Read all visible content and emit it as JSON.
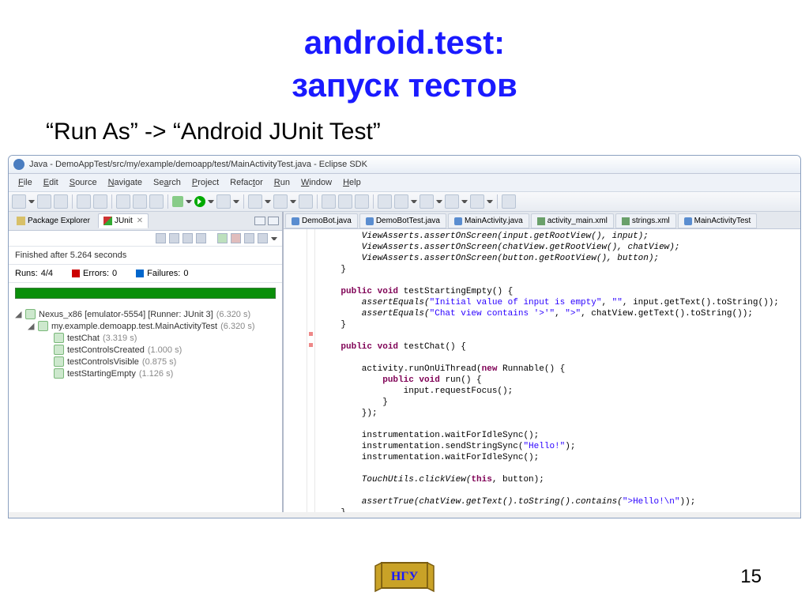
{
  "slide": {
    "title1": "android.test:",
    "title2": "запуск тестов",
    "subtitle": "“Run As” -> “Android JUnit Test”",
    "pageNum": "15"
  },
  "window": {
    "title": "Java - DemoAppTest/src/my/example/demoapp/test/MainActivityTest.java - Eclipse SDK"
  },
  "menu": [
    "File",
    "Edit",
    "Source",
    "Navigate",
    "Search",
    "Project",
    "Refactor",
    "Run",
    "Window",
    "Help"
  ],
  "leftPanel": {
    "tabs": {
      "pe": "Package Explorer",
      "junit": "JUnit"
    },
    "status": "Finished after 5.264 seconds",
    "runsLabel": "Runs:",
    "runsVal": "4/4",
    "errLabel": "Errors:",
    "errVal": "0",
    "failLabel": "Failures:",
    "failVal": "0",
    "tree": {
      "root": {
        "label": "Nexus_x86 [emulator-5554] [Runner: JUnit 3]",
        "dur": "(6.320 s)"
      },
      "pkg": {
        "label": "my.example.demoapp.test.MainActivityTest",
        "dur": "(6.320 s)"
      },
      "t1": {
        "label": "testChat",
        "dur": "(3.319 s)"
      },
      "t2": {
        "label": "testControlsCreated",
        "dur": "(1.000 s)"
      },
      "t3": {
        "label": "testControlsVisible",
        "dur": "(0.875 s)"
      },
      "t4": {
        "label": "testStartingEmpty",
        "dur": "(1.126 s)"
      }
    }
  },
  "editorTabs": [
    "DemoBot.java",
    "DemoBotTest.java",
    "MainActivity.java",
    "activity_main.xml",
    "strings.xml",
    "MainActivityTest"
  ],
  "code": {
    "l1": "        ViewAsserts.assertOnScreen(input.getRootView(), input);",
    "l2": "        ViewAsserts.assertOnScreen(chatView.getRootView(), chatView);",
    "l3": "        ViewAsserts.assertOnScreen(button.getRootView(), button);",
    "l4": "    }",
    "l5": "",
    "l6a": "    ",
    "l6kw": "public void",
    "l6b": " testStartingEmpty() {",
    "l7a": "        assertEquals(",
    "l7s1": "\"Initial value of input is empty\"",
    "l7b": ", ",
    "l7s2": "\"\"",
    "l7c": ", input.getText().toString());",
    "l8a": "        assertEquals(",
    "l8s1": "\"Chat view contains '>'\"",
    "l8b": ", ",
    "l8s2": "\">\"",
    "l8c": ", chatView.getText().toString());",
    "l9": "    }",
    "l10": "",
    "l11a": "    ",
    "l11kw": "public void",
    "l11b": " testChat() {",
    "l12": "",
    "l13a": "        activity.runOnUiThread(",
    "l13kw": "new",
    "l13b": " Runnable() {",
    "l14a": "            ",
    "l14kw": "public void",
    "l14b": " run() {",
    "l15": "                input.requestFocus();",
    "l16": "            }",
    "l17": "        });",
    "l18": "",
    "l19": "        instrumentation.waitForIdleSync();",
    "l20a": "        instrumentation.sendStringSync(",
    "l20s": "\"Hello!\"",
    "l20b": ");",
    "l21": "        instrumentation.waitForIdleSync();",
    "l22": "",
    "l23a": "        TouchUtils.clickView(",
    "l23kw": "this",
    "l23b": ", button);",
    "l24": "",
    "l25a": "        assertTrue(chatView.getText().toString().contains(",
    "l25s": "\">Hello!\\n\"",
    "l25b": "));",
    "l26": "    }",
    "l27": "}"
  }
}
